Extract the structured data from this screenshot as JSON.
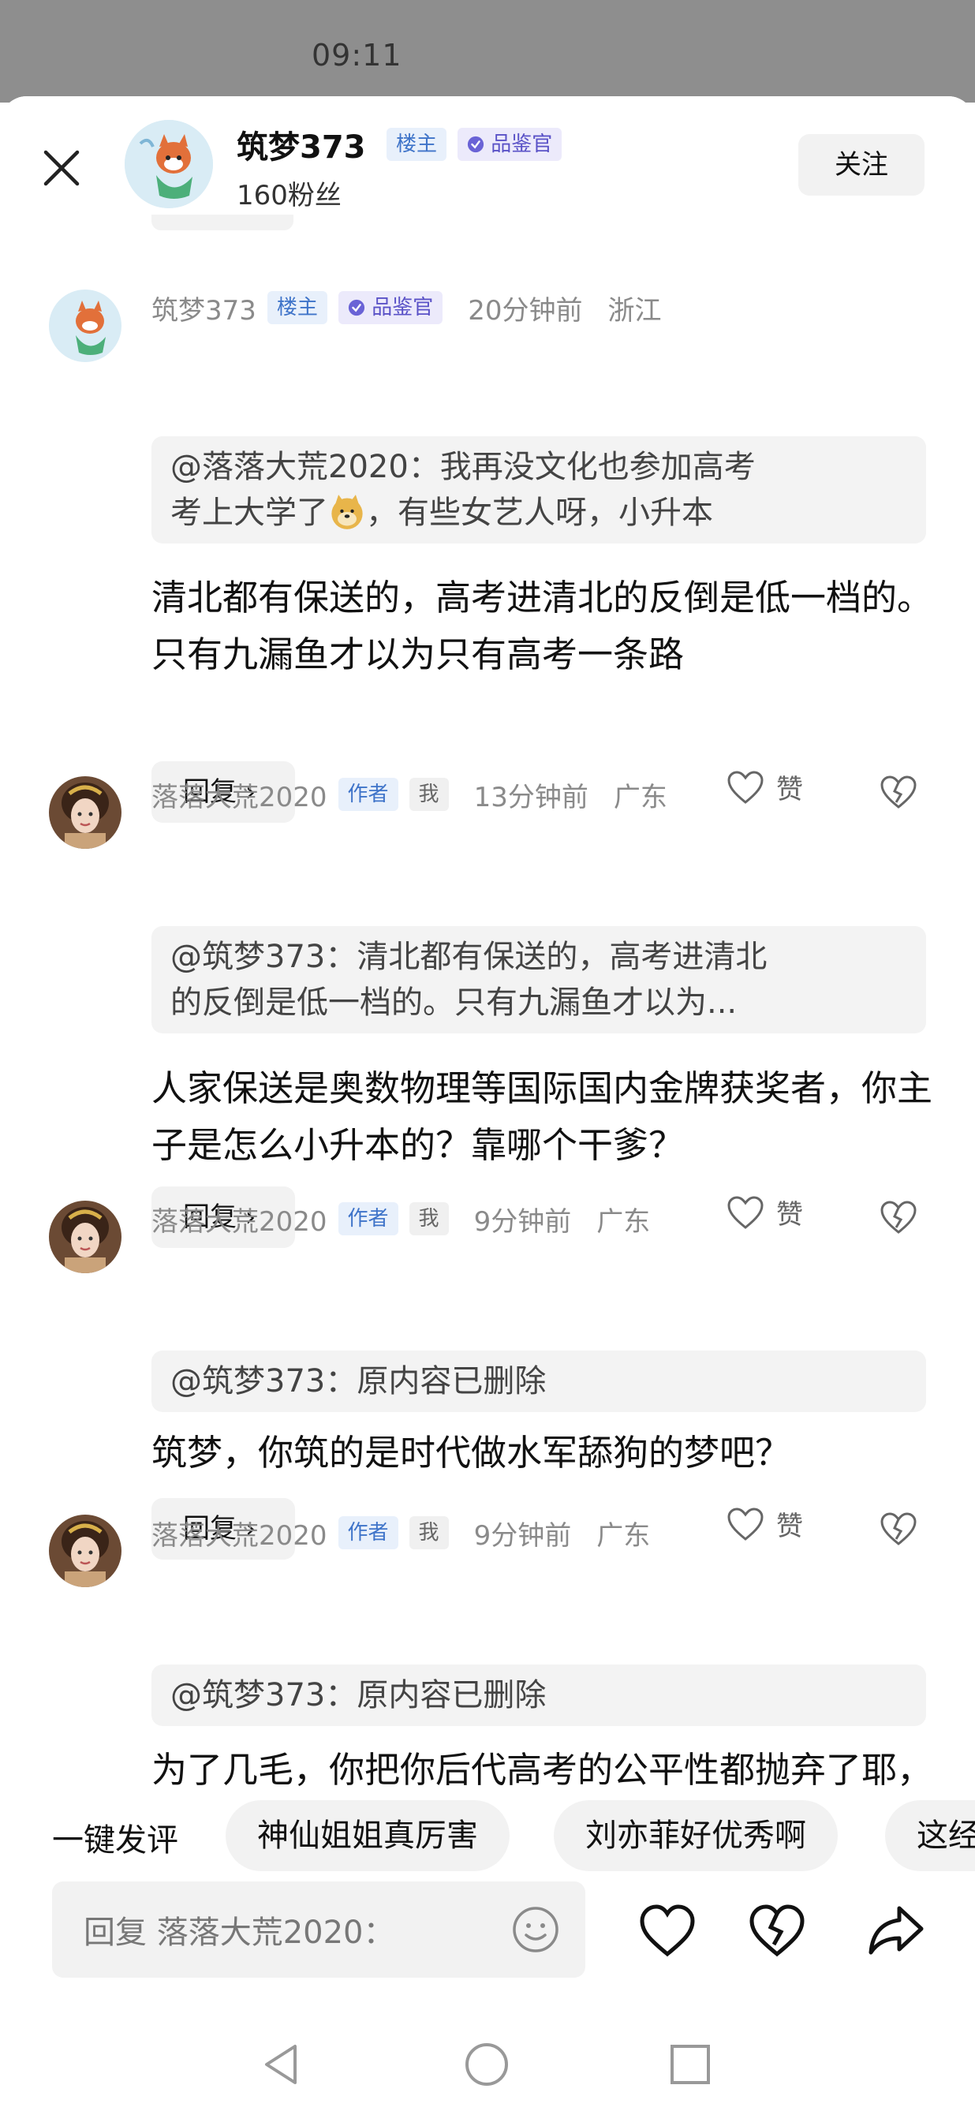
{
  "status_bar": {
    "time": "09:11"
  },
  "header": {
    "name": "筑梦373",
    "badges": [
      "楼主",
      "品鉴官"
    ],
    "fans": "160粉丝",
    "follow_label": "关注"
  },
  "comments": [
    {
      "user": "筑梦373",
      "badges": [
        "楼主",
        "品鉴官"
      ],
      "time": "20分钟前",
      "location": "浙江",
      "quote_line1": "@落落大荒2020：我再没文化也参加高考",
      "quote_line2a": "考上大学了",
      "quote_line2b": "，有些女艺人呀，小升本",
      "body": "清北都有保送的，高考进清北的反倒是低一档的。只有九漏鱼才以为只有高考一条路",
      "reply_label": "回复 ›",
      "like_label": "赞"
    },
    {
      "user": "落落大荒2020",
      "badges": [
        "作者",
        "我"
      ],
      "time": "13分钟前",
      "location": "广东",
      "quote_line1": "@筑梦373：清北都有保送的，高考进清北",
      "quote_line2": "的反倒是低一档的。只有九漏鱼才以为...",
      "body": "人家保送是奥数物理等国际国内金牌获奖者，你主子是怎么小升本的？靠哪个干爹？",
      "reply_label": "回复 ›",
      "like_label": "赞"
    },
    {
      "user": "落落大荒2020",
      "badges": [
        "作者",
        "我"
      ],
      "time": "9分钟前",
      "location": "广东",
      "quote_line1": "@筑梦373：原内容已删除",
      "body": "筑梦，你筑的是时代做水军舔狗的梦吧？",
      "reply_label": "回复 ›",
      "like_label": "赞"
    },
    {
      "user": "落落大荒2020",
      "badges": [
        "作者",
        "我"
      ],
      "time": "9分钟前",
      "location": "广东",
      "quote_line1": "@筑梦373：原内容已删除",
      "body": "为了几毛，你把你后代高考的公平性都抛弃了耶，啧啧啧"
    }
  ],
  "quick_comment": {
    "label": "一键发评",
    "chips": [
      "神仙姐姐真厉害",
      "刘亦菲好优秀啊",
      "这经"
    ]
  },
  "input_bar": {
    "placeholder": "回复 落落大荒2020："
  },
  "icons": [
    "close-icon",
    "verified-icon",
    "heart-icon",
    "broken-heart-icon",
    "emoji-icon",
    "share-icon",
    "nav-back-icon",
    "nav-home-icon",
    "nav-recent-icon"
  ],
  "colors": {
    "badge_blue": "#3f74c9",
    "badge_purple": "#5a52c7",
    "chip_bg": "#f2f2f2"
  }
}
